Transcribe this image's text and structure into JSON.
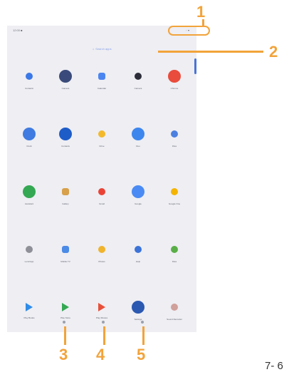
{
  "status_bar": {
    "time": "12:00 ■",
    "right": "◦ ▾"
  },
  "search_label": "☼ Search apps",
  "apps": [
    [
      {
        "label": "Contacts",
        "icon": "sparkle-icon",
        "color": "#3b78e7",
        "shape": "small"
      },
      {
        "label": "Camera",
        "icon": "camera-icon",
        "color": "#3a4a7a",
        "shape": "circle"
      },
      {
        "label": "Calendar",
        "icon": "calendar-icon",
        "color": "#4b85f0",
        "shape": "square-small"
      },
      {
        "label": "Camera",
        "icon": "dot-icon",
        "color": "#2d2d3a",
        "shape": "small"
      },
      {
        "label": "Chrome",
        "icon": "chrome-icon",
        "color": "#e94b3c",
        "shape": "circle"
      }
    ],
    [
      {
        "label": "Clock",
        "icon": "clock-icon",
        "color": "#3f7be0",
        "shape": "circle"
      },
      {
        "label": "Contacts",
        "icon": "contact-icon",
        "color": "#1e5cc8",
        "shape": "circle"
      },
      {
        "label": "Drive",
        "icon": "drive-icon",
        "color": "#f3b92b",
        "shape": "small"
      },
      {
        "label": "Duo",
        "icon": "duo-icon",
        "color": "#3d86ee",
        "shape": "circle"
      },
      {
        "label": "Files",
        "icon": "files-icon",
        "color": "#4b7fe0",
        "shape": "small"
      }
    ],
    [
      {
        "label": "Assistant",
        "icon": "assistant-icon",
        "color": "#34a853",
        "shape": "circle"
      },
      {
        "label": "Gallery",
        "icon": "gallery-icon",
        "color": "#d8a04a",
        "shape": "square-small"
      },
      {
        "label": "Gmail",
        "icon": "gmail-icon",
        "color": "#ea4335",
        "shape": "small"
      },
      {
        "label": "Google",
        "icon": "google-icon",
        "color": "#4a8af4",
        "shape": "circle"
      },
      {
        "label": "Google One",
        "icon": "one-icon",
        "color": "#f4b400",
        "shape": "small"
      }
    ],
    [
      {
        "label": "Lens/App",
        "icon": "dash-icon",
        "color": "#8f8f98",
        "shape": "small"
      },
      {
        "label": "Mobile TV",
        "icon": "tv-icon",
        "color": "#4c8be6",
        "shape": "square-small"
      },
      {
        "label": "Photos",
        "icon": "photos-icon",
        "color": "#f0b32c",
        "shape": "small"
      },
      {
        "label": "Help",
        "icon": "help-icon",
        "color": "#3c73d8",
        "shape": "small"
      },
      {
        "label": "Files",
        "icon": "maps-icon",
        "color": "#5aae47",
        "shape": "small"
      }
    ],
    [
      {
        "label": "Play Books",
        "icon": "play-books-icon",
        "color": "#2f8ce8",
        "shape": "tri"
      },
      {
        "label": "Play Store",
        "icon": "play-store-icon",
        "color": "#34a853",
        "shape": "tri-big"
      },
      {
        "label": "Play Movies",
        "icon": "play-movies-icon",
        "color": "#e8503a",
        "shape": "tri"
      },
      {
        "label": "Settings",
        "icon": "settings-icon",
        "color": "#2b58b0",
        "shape": "circle"
      },
      {
        "label": "Sound Recorder",
        "icon": "recorder-icon",
        "color": "#d0a09a",
        "shape": "small"
      }
    ]
  ],
  "page_indicator": [
    "•",
    "•",
    "•"
  ],
  "callouts": [
    "1",
    "2",
    "3",
    "4",
    "5"
  ],
  "page_number": "7- 6"
}
